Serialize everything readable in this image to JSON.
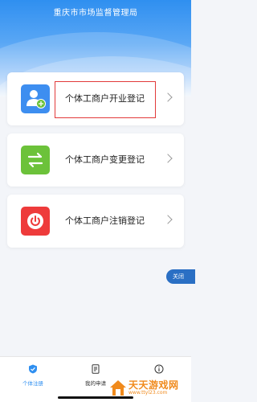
{
  "header": {
    "title": "重庆市市场监督管理局"
  },
  "cards": [
    {
      "label": "个体工商户开业登记",
      "icon": "add-user-icon",
      "color": "#3d8ef0"
    },
    {
      "label": "个体工商户变更登记",
      "icon": "swap-arrows-icon",
      "color": "#6cc23a"
    },
    {
      "label": "个体工商户注销登记",
      "icon": "power-icon",
      "color": "#ee3b3b"
    }
  ],
  "close_button": {
    "label": "关闭"
  },
  "tabs": [
    {
      "label": "个体注册",
      "icon": "shield-check-icon",
      "active": true
    },
    {
      "label": "我的申请",
      "icon": "document-icon",
      "active": false
    },
    {
      "label": "",
      "icon": "info-icon",
      "active": false
    }
  ],
  "watermark": {
    "text": "天天游戏网",
    "url": "www.ttyl23.com"
  },
  "colors": {
    "accent": "#2f8ff0",
    "highlight_border": "#e23a3a"
  }
}
